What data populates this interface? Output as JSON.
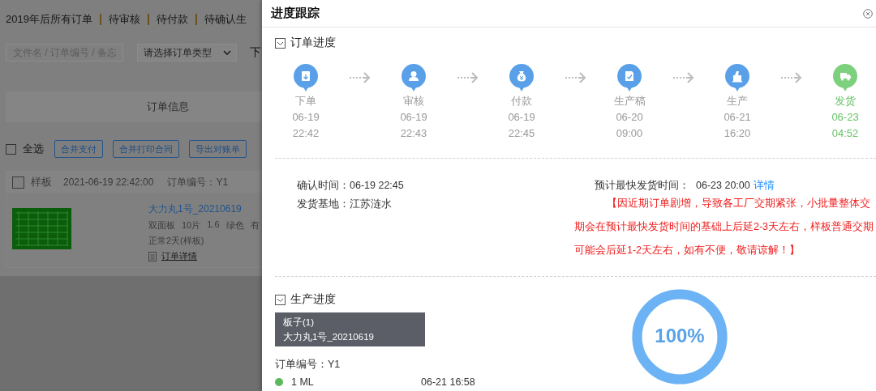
{
  "background_page": {
    "tabs": [
      {
        "label": "2019年后所有订单"
      },
      {
        "label": "待审核"
      },
      {
        "label": "待付款"
      },
      {
        "label": "待确认生"
      }
    ],
    "search": {
      "placeholder": "文件名 / 订单编号 / 备忘"
    },
    "type_select": {
      "value": "请选择订单类型"
    },
    "cut_label": "下",
    "table_header": "订单信息",
    "select_all": {
      "label": "全选",
      "checked": false
    },
    "buttons": [
      "合并支付",
      "合并打印合同",
      "导出对账单"
    ],
    "order": {
      "checked": false,
      "type": "样板",
      "time": "2021-06-19 22:42:00",
      "order_no": "订单编号：Y1",
      "name": "大力丸1号_20210619",
      "specs": [
        "双面板",
        "10片",
        "1.6",
        "绿色",
        "有"
      ],
      "lead_time": "正常2天(样板)",
      "detail_link": "订单详情"
    }
  },
  "modal": {
    "title": "进度跟踪",
    "order_progress": {
      "title": "订单进度",
      "expanded": true,
      "steps": [
        {
          "label": "下单",
          "date": "06-19",
          "time": "22:42",
          "current": false
        },
        {
          "label": "审核",
          "date": "06-19",
          "time": "22:43",
          "current": false
        },
        {
          "label": "付款",
          "date": "06-19",
          "time": "22:45",
          "current": false
        },
        {
          "label": "生产稿",
          "date": "06-20",
          "time": "09:00",
          "current": false
        },
        {
          "label": "生产",
          "date": "06-21",
          "time": "16:20",
          "current": false
        },
        {
          "label": "发货",
          "date": "06-23",
          "time": "04:52",
          "current": true
        }
      ]
    },
    "info": {
      "confirm_time": "确认时间：06-19 22:45",
      "ship_base": "发货基地：江苏涟水",
      "estimate_label": "预计最快发货时间：",
      "estimate_value": "06-23 20:00",
      "detail_link": "详情",
      "notice": "【因近期订单剧增，导致各工厂交期紧张，小批量整体交期会在预计最快发货时间的基础上后延2-3天左右，样板普通交期可能会后延1-2天左右，如有不便，敬请谅解！】"
    },
    "production": {
      "title": "生产进度",
      "expanded": true,
      "board_title": "板子(1)",
      "board_name": "大力丸1号_20210619",
      "order_no": "订单编号：Y1",
      "level": 1,
      "percent": "100%",
      "records": [
        {
          "name": "1 ML",
          "time": "06-21 16:58"
        }
      ]
    }
  }
}
